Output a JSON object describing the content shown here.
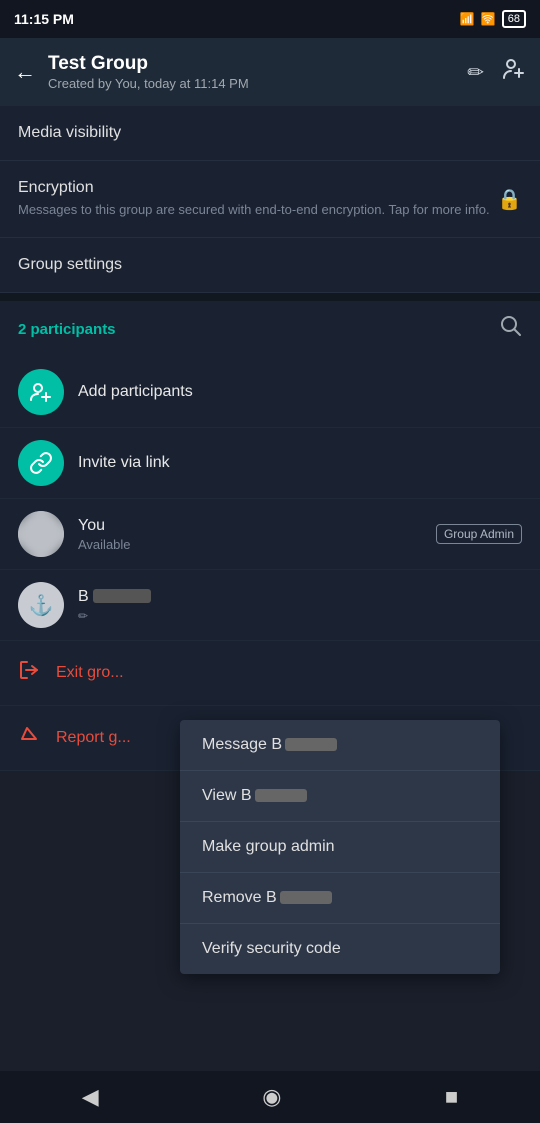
{
  "statusBar": {
    "time": "11:15 PM",
    "battery": "68"
  },
  "header": {
    "title": "Test Group",
    "subtitle": "Created by You, today at 11:14 PM",
    "backLabel": "←",
    "editIcon": "✏",
    "addPersonIcon": "👤+"
  },
  "mediaVisibility": {
    "label": "Media visibility"
  },
  "encryption": {
    "label": "Encryption",
    "description": "Messages to this group are secured with end-to-end encryption. Tap for more info."
  },
  "groupSettings": {
    "label": "Group settings"
  },
  "participants": {
    "countLabel": "2 participants",
    "addLabel": "Add participants",
    "inviteLabel": "Invite via link"
  },
  "members": [
    {
      "name": "You",
      "status": "Available",
      "badge": "Group Admin",
      "isYou": true
    },
    {
      "name": "B",
      "nameRedacted": true,
      "status": "✏",
      "badge": "",
      "isYou": false
    }
  ],
  "actions": {
    "exitLabel": "Exit gro...",
    "reportLabel": "Report g..."
  },
  "contextMenu": {
    "items": [
      "Message B████",
      "View B████",
      "Make group admin",
      "Remove B████",
      "Verify security code"
    ]
  },
  "bottomNav": {
    "back": "◀",
    "home": "◉",
    "square": "■"
  }
}
